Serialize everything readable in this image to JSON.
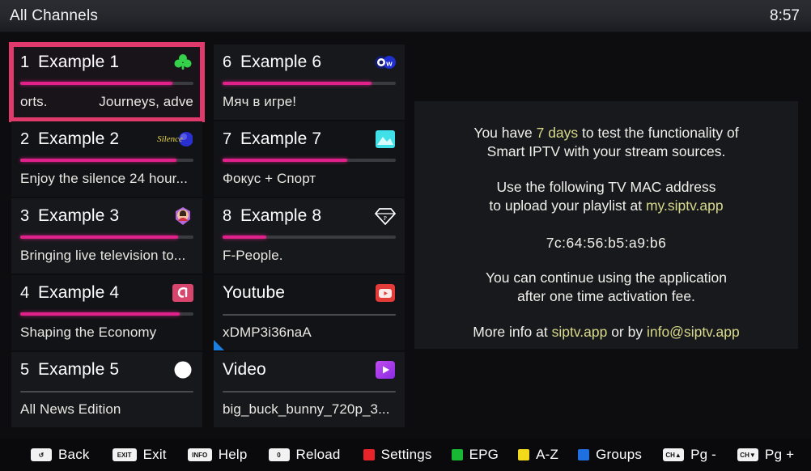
{
  "header": {
    "title": "All Channels",
    "clock": "8:57"
  },
  "channels": [
    {
      "number": "1",
      "name": "Example 1",
      "desc_left": "orts.",
      "desc_right": "Journeys, adve",
      "progress": 88,
      "has_progress": true,
      "selected": true,
      "logo": "clover-green-icon",
      "marker": false
    },
    {
      "number": "6",
      "name": "Example 6",
      "desc_left": "Мяч в игре!",
      "desc_right": "",
      "progress": 86,
      "has_progress": true,
      "selected": false,
      "logo": "dw-icon",
      "marker": false
    },
    {
      "number": "2",
      "name": "Example 2",
      "desc_left": "Enjoy the silence 24 hour...",
      "desc_right": "",
      "progress": 90,
      "has_progress": true,
      "selected": false,
      "logo": "silence-script-icon",
      "marker": false
    },
    {
      "number": "7",
      "name": "Example 7",
      "desc_left": "Фокус + Спорт",
      "desc_right": "",
      "progress": 72,
      "has_progress": true,
      "selected": false,
      "logo": "cyan-photo-icon",
      "marker": false
    },
    {
      "number": "3",
      "name": "Example 3",
      "desc_left": "Bringing live television to...",
      "desc_right": "",
      "progress": 91,
      "has_progress": true,
      "selected": false,
      "logo": "portrait-badge-icon",
      "marker": false
    },
    {
      "number": "8",
      "name": "Example 8",
      "desc_left": "F-People.",
      "desc_right": "",
      "progress": 25,
      "has_progress": true,
      "selected": false,
      "logo": "diamond-outline-icon",
      "marker": false
    },
    {
      "number": "4",
      "name": "Example 4",
      "desc_left": "Shaping the Economy",
      "desc_right": "",
      "progress": 92,
      "has_progress": true,
      "selected": false,
      "logo": "pink-a-icon",
      "marker": false
    },
    {
      "number": "",
      "name": "Youtube",
      "desc_left": "xDMP3i36naA",
      "desc_right": "",
      "progress": 0,
      "has_progress": false,
      "selected": false,
      "logo": "youtube-icon",
      "marker": true
    },
    {
      "number": "5",
      "name": "Example 5",
      "desc_left": "All News Edition",
      "desc_right": "",
      "progress": 0,
      "has_progress": false,
      "selected": false,
      "logo": "white-circle-icon",
      "marker": false
    },
    {
      "number": "",
      "name": "Video",
      "desc_left": "big_buck_bunny_720p_3...",
      "desc_right": "",
      "progress": 0,
      "has_progress": false,
      "selected": false,
      "logo": "purple-play-icon",
      "marker": false
    }
  ],
  "info": {
    "line1_a": "You have ",
    "line1_hl": "7 days",
    "line1_b": " to test the functionality of",
    "line1_c": "Smart IPTV with your stream sources.",
    "line2_a": "Use the following TV MAC address",
    "line2_b": "to upload your playlist at ",
    "line2_hl": "my.siptv.app",
    "mac": "7c:64:56:b5:a9:b6",
    "line3_a": "You can continue using the application",
    "line3_b": "after one time activation fee.",
    "line4_a": "More info at ",
    "line4_hl1": "siptv.app",
    "line4_b": " or by ",
    "line4_hl2": "info@siptv.app"
  },
  "bottombar": [
    {
      "key": "back-key",
      "cap": "↺",
      "label": "Back",
      "type": "cap"
    },
    {
      "key": "exit-key",
      "cap": "EXIT",
      "label": "Exit",
      "type": "cap"
    },
    {
      "key": "info-key",
      "cap": "INFO",
      "label": "Help",
      "type": "cap"
    },
    {
      "key": "zero-key",
      "cap": "0",
      "label": "Reload",
      "type": "cap"
    },
    {
      "key": "red-key",
      "cap": "",
      "label": "Settings",
      "type": "sq",
      "color": "#e8242a"
    },
    {
      "key": "green-key",
      "cap": "",
      "label": "EPG",
      "type": "sq",
      "color": "#18b834"
    },
    {
      "key": "yellow-key",
      "cap": "",
      "label": "A-Z",
      "type": "sq",
      "color": "#f2d91a"
    },
    {
      "key": "blue-key",
      "cap": "",
      "label": "Groups",
      "type": "sq",
      "color": "#1e6fe0"
    },
    {
      "key": "ch-up-key",
      "cap": "CH▲",
      "label": "Pg -",
      "type": "cap"
    },
    {
      "key": "ch-down-key",
      "cap": "CH▼",
      "label": "Pg +",
      "type": "cap"
    }
  ]
}
